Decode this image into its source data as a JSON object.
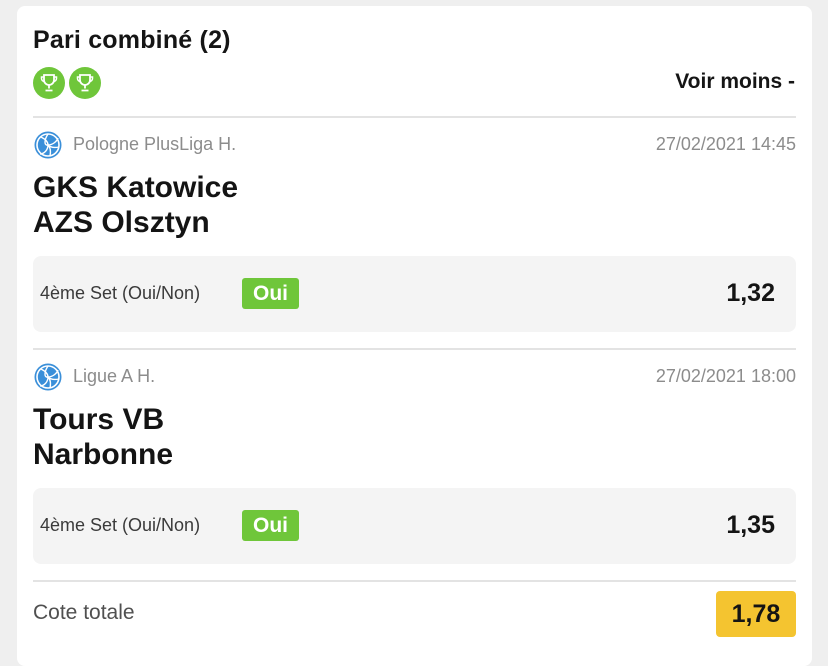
{
  "header": {
    "title": "Pari combiné (2)",
    "toggle_label": "Voir moins -",
    "trophy_icons": [
      "trophy-icon",
      "trophy-icon"
    ]
  },
  "bets": [
    {
      "sport_icon": "volleyball-icon",
      "league": "Pologne PlusLiga H.",
      "datetime": "27/02/2021 14:45",
      "team_home": "GKS Katowice",
      "team_away": "AZS Olsztyn",
      "market": "4ème Set (Oui/Non)",
      "selection": "Oui",
      "odds": "1,32"
    },
    {
      "sport_icon": "volleyball-icon",
      "league": "Ligue A H.",
      "datetime": "27/02/2021 18:00",
      "team_home": "Tours VB",
      "team_away": "Narbonne",
      "market": "4ème Set (Oui/Non)",
      "selection": "Oui",
      "odds": "1,35"
    }
  ],
  "total": {
    "label": "Cote totale",
    "value": "1,78"
  },
  "colors": {
    "accent_green": "#6fc63a",
    "total_yellow": "#f4c430",
    "sport_icon_blue": "#3a8fd9"
  }
}
